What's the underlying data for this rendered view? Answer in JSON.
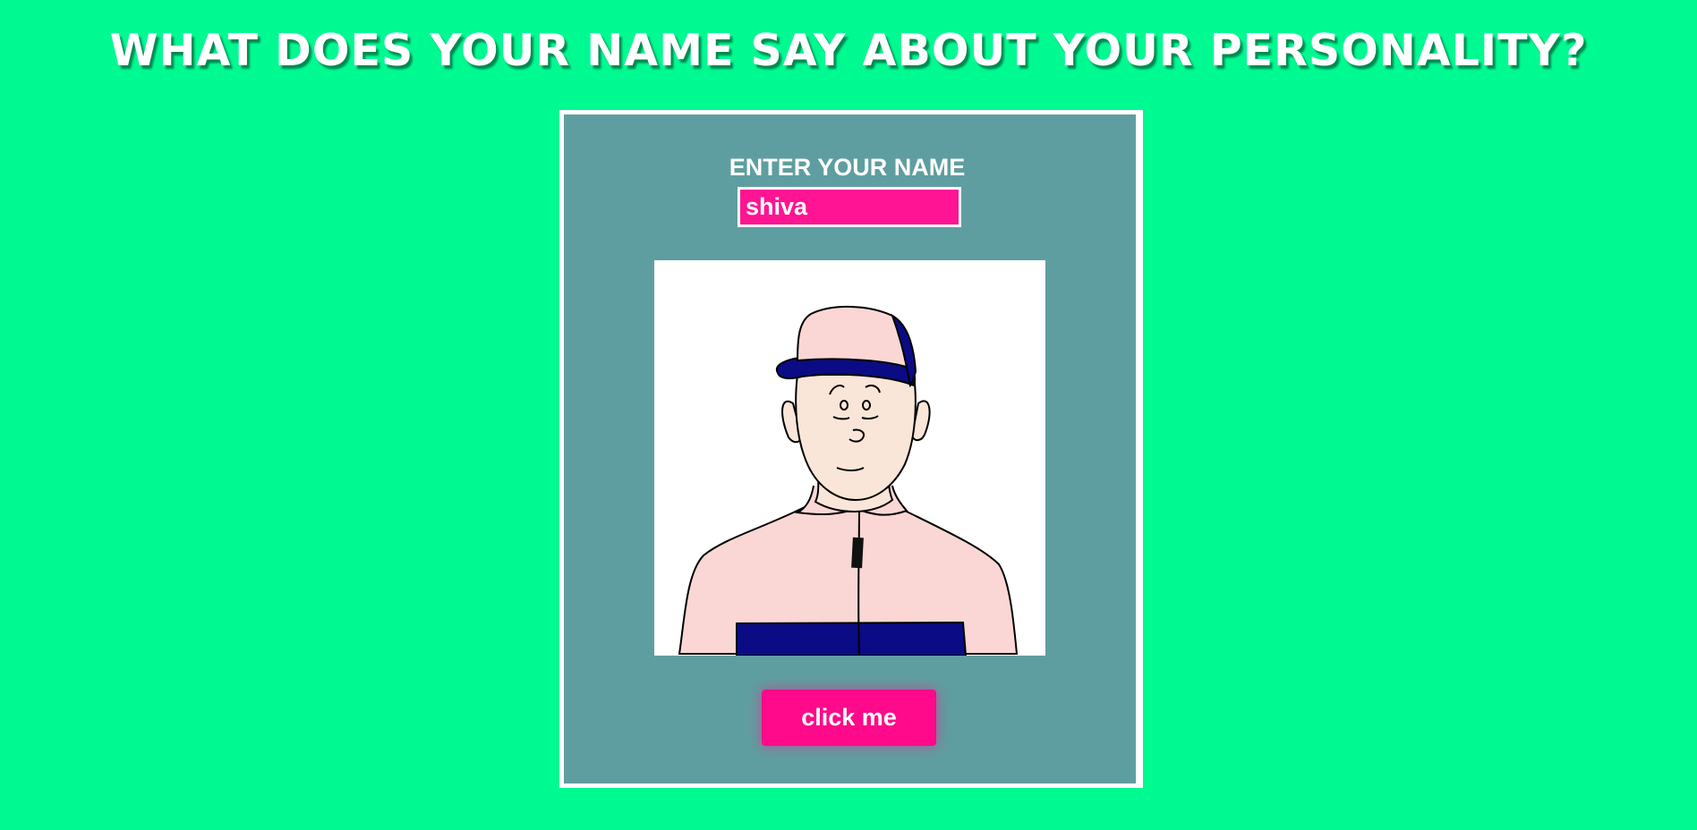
{
  "header": {
    "title": "WHAT DOES YOUR NAME SAY ABOUT YOUR PERSONALITY?"
  },
  "form": {
    "label": "ENTER YOUR NAME",
    "name_value": "shiva"
  },
  "avatar": {
    "icon": "cartoon-person-with-cap"
  },
  "button": {
    "label": "click me"
  },
  "colors": {
    "background": "#00fa92",
    "card": "#5f9ea0",
    "input": "#ff1493",
    "button": "#ff0a8a",
    "jacket": "#fad7d5",
    "navy": "#0b0b86",
    "skin": "#fae6d8"
  }
}
